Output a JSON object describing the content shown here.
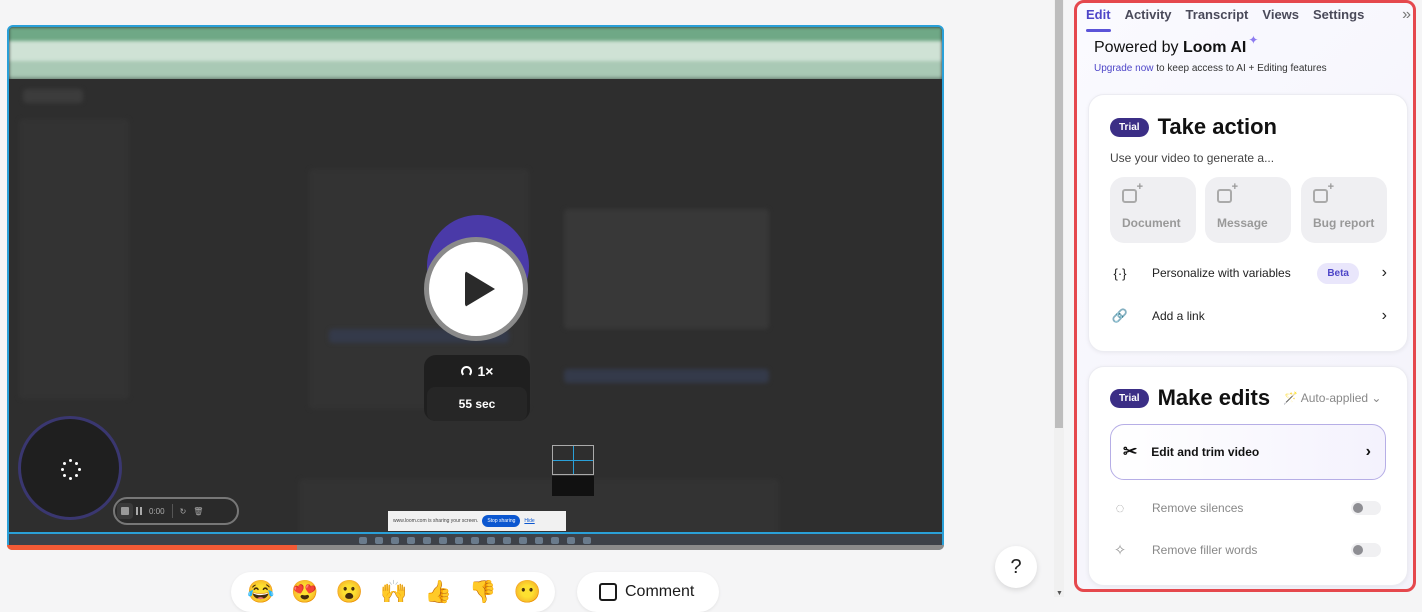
{
  "player": {
    "speed": "1×",
    "duration": "55 sec",
    "progress_fraction": 0.31,
    "recorder": {
      "time": "0:00"
    },
    "share_bar": {
      "message": "www.loom.com is sharing your screen.",
      "stop_label": "Stop sharing",
      "hide_label": "Hide"
    }
  },
  "reactions": [
    "😂",
    "😍",
    "😮",
    "🙌",
    "👍",
    "👎",
    "😶"
  ],
  "comment_label": "Comment",
  "help_label": "?",
  "panel": {
    "tabs": [
      "Edit",
      "Activity",
      "Transcript",
      "Views",
      "Settings"
    ],
    "active_tab": "Edit",
    "collapse_icon": "»",
    "powered_prefix": "Powered by ",
    "powered_brand": "Loom AI",
    "sparkle": "✦",
    "upgrade_link": "Upgrade now",
    "upgrade_rest": " to keep access to AI + Editing features",
    "take_action": {
      "badge": "Trial",
      "title": "Take action",
      "subtitle": "Use your video to generate a...",
      "tiles": [
        "Document",
        "Message",
        "Bug report"
      ],
      "rows": [
        {
          "icon": "{·}",
          "label": "Personalize with variables",
          "badge": "Beta",
          "chevron": "›"
        },
        {
          "icon": "🔗",
          "label": "Add a link",
          "chevron": "›"
        }
      ]
    },
    "make_edits": {
      "badge": "Trial",
      "title": "Make edits",
      "auto_applied": "Auto-applied ⌄",
      "edit_trim": {
        "icon": "✂",
        "label": "Edit and trim video",
        "chevron": "›"
      },
      "toggles": [
        {
          "icon": "◌",
          "label": "Remove silences",
          "on": false
        },
        {
          "icon": "✧",
          "label": "Remove filler words",
          "on": false
        }
      ]
    }
  },
  "colors": {
    "accent": "#4e46c8",
    "trial_badge": "#3b2e86",
    "progress": "#f25a36",
    "highlight_border": "#e5484d"
  }
}
